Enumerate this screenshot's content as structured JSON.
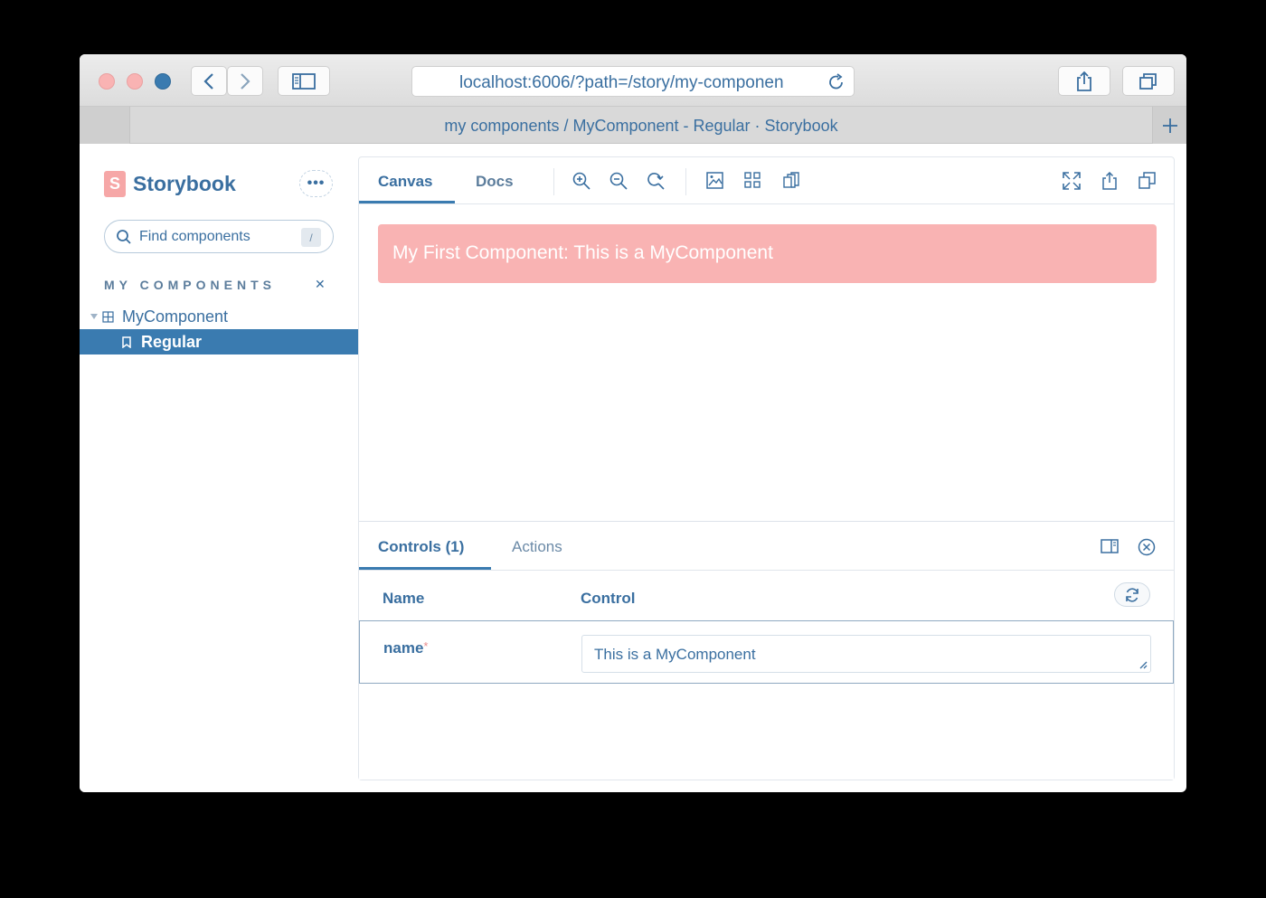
{
  "browser": {
    "url": "localhost:6006/?path=/story/my-componen",
    "tab_title": "my components / MyComponent - Regular · Storybook",
    "new_tab_label": "+"
  },
  "sidebar": {
    "logo_letter": "S",
    "logo_text": "Storybook",
    "menu_label": "•••",
    "search_placeholder": "Find components",
    "search_shortcut": "/",
    "section_title": "MY COMPONENTS",
    "collapse_icon": "✕",
    "tree": {
      "component": "MyComponent",
      "story": "Regular"
    }
  },
  "main": {
    "tabs": [
      "Canvas",
      "Docs"
    ],
    "active_tab": "Canvas",
    "preview_text": "My First Component: This is a MyComponent"
  },
  "addons": {
    "tabs": [
      "Controls (1)",
      "Actions"
    ],
    "active_tab": "Controls (1)",
    "columns": [
      "Name",
      "Control"
    ],
    "args": [
      {
        "name": "name",
        "required_mark": "*",
        "value": "This is a MyComponent"
      }
    ]
  },
  "colors": {
    "accent": "#3a7bb0",
    "text_blue": "#3a6fa0",
    "preview_bg": "#f9b3b3"
  }
}
